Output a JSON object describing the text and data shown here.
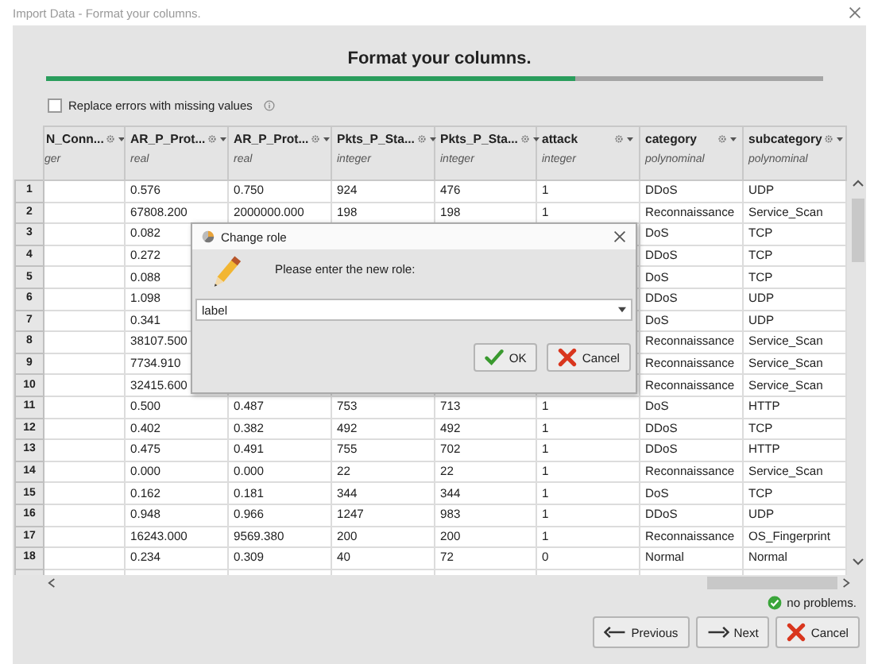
{
  "window": {
    "title": "Import Data - Format your columns."
  },
  "heading": "Format your columns.",
  "progress": {
    "level": 0.68
  },
  "replace_errors": {
    "label": "Replace errors with missing values",
    "checked": false
  },
  "table": {
    "columns": [
      {
        "name": "N_Conn...",
        "type": "ger"
      },
      {
        "name": "AR_P_Prot...",
        "type": "real"
      },
      {
        "name": "AR_P_Prot...",
        "type": "real"
      },
      {
        "name": "Pkts_P_Sta...",
        "type": "integer"
      },
      {
        "name": "Pkts_P_Sta...",
        "type": "integer"
      },
      {
        "name": "attack",
        "type": "integer"
      },
      {
        "name": "category",
        "type": "polynominal"
      },
      {
        "name": "subcategory",
        "type": "polynominal"
      }
    ],
    "rows": [
      {
        "index": "1",
        "cells": [
          null,
          "0.576",
          "0.750",
          "924",
          "476",
          "1",
          "DDoS",
          "UDP"
        ]
      },
      {
        "index": "2",
        "cells": [
          null,
          "67808.200",
          "2000000.000",
          "198",
          "198",
          "1",
          "Reconnaissance",
          "Service_Scan"
        ]
      },
      {
        "index": "3",
        "cells": [
          null,
          "0.082",
          null,
          null,
          null,
          null,
          "DoS",
          "TCP"
        ]
      },
      {
        "index": "4",
        "cells": [
          null,
          "0.272",
          null,
          null,
          null,
          null,
          "DDoS",
          "TCP"
        ]
      },
      {
        "index": "5",
        "cells": [
          null,
          "0.088",
          null,
          null,
          null,
          null,
          "DoS",
          "TCP"
        ]
      },
      {
        "index": "6",
        "cells": [
          null,
          "1.098",
          null,
          null,
          null,
          null,
          "DDoS",
          "UDP"
        ]
      },
      {
        "index": "7",
        "cells": [
          null,
          "0.341",
          null,
          null,
          null,
          null,
          "DoS",
          "UDP"
        ]
      },
      {
        "index": "8",
        "cells": [
          null,
          "38107.500",
          null,
          null,
          null,
          null,
          "Reconnaissance",
          "Service_Scan"
        ]
      },
      {
        "index": "9",
        "cells": [
          null,
          "7734.910",
          null,
          null,
          null,
          null,
          "Reconnaissance",
          "Service_Scan"
        ]
      },
      {
        "index": "10",
        "cells": [
          null,
          "32415.600",
          null,
          null,
          null,
          null,
          "Reconnaissance",
          "Service_Scan"
        ]
      },
      {
        "index": "11",
        "cells": [
          null,
          "0.500",
          "0.487",
          "753",
          "713",
          "1",
          "DoS",
          "HTTP"
        ]
      },
      {
        "index": "12",
        "cells": [
          null,
          "0.402",
          "0.382",
          "492",
          "492",
          "1",
          "DDoS",
          "TCP"
        ]
      },
      {
        "index": "13",
        "cells": [
          null,
          "0.475",
          "0.491",
          "755",
          "702",
          "1",
          "DDoS",
          "HTTP"
        ]
      },
      {
        "index": "14",
        "cells": [
          null,
          "0.000",
          "0.000",
          "22",
          "22",
          "1",
          "Reconnaissance",
          "Service_Scan"
        ]
      },
      {
        "index": "15",
        "cells": [
          null,
          "0.162",
          "0.181",
          "344",
          "344",
          "1",
          "DoS",
          "TCP"
        ]
      },
      {
        "index": "16",
        "cells": [
          null,
          "0.948",
          "0.966",
          "1247",
          "983",
          "1",
          "DDoS",
          "UDP"
        ]
      },
      {
        "index": "17",
        "cells": [
          null,
          "16243.000",
          "9569.380",
          "200",
          "200",
          "1",
          "Reconnaissance",
          "OS_Fingerprint"
        ]
      },
      {
        "index": "18",
        "cells": [
          null,
          "0.234",
          "0.309",
          "40",
          "72",
          "0",
          "Normal",
          "Normal"
        ]
      }
    ]
  },
  "status": "no problems.",
  "buttons": [
    {
      "kind": "previous",
      "label": "Previous"
    },
    {
      "kind": "next",
      "label": "Next"
    },
    {
      "kind": "cancel",
      "label": "Cancel"
    }
  ],
  "dialog": {
    "title": "Change role",
    "prompt": "Please enter the new role:",
    "value": "label",
    "buttons": [
      {
        "kind": "ok",
        "label": "OK"
      },
      {
        "kind": "cancel",
        "label": "Cancel"
      }
    ]
  }
}
